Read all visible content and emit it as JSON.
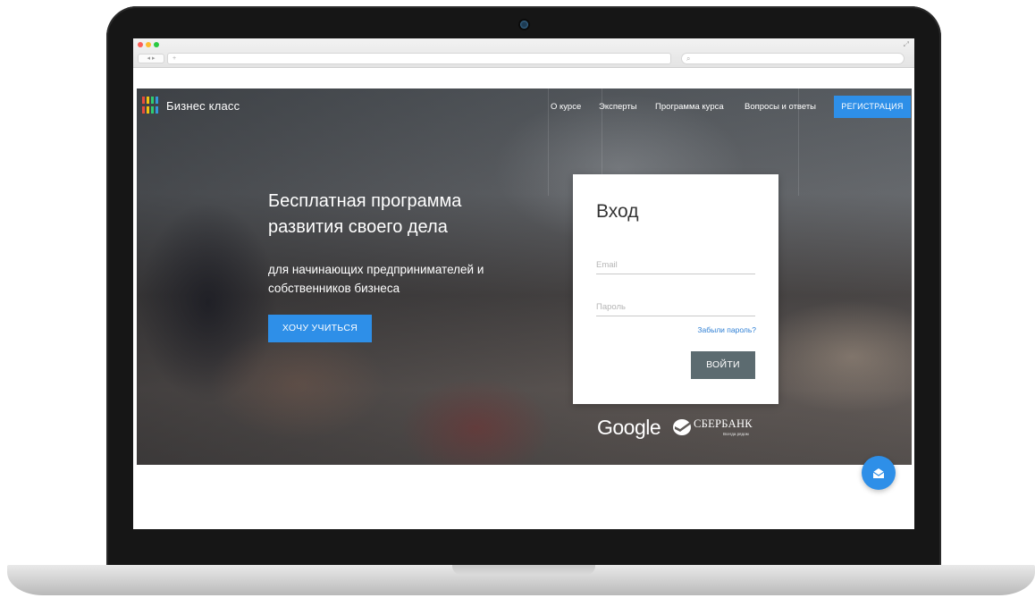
{
  "browser": {
    "nav_arrows": "◂ ▸",
    "url_prefix": "+",
    "search_glyph": "⌕",
    "expand_glyph": "⤢"
  },
  "site": {
    "brand": "Бизнес класс",
    "logo_colors": [
      "#e74c3c",
      "#f1c40f",
      "#2ecc71",
      "#3498db"
    ],
    "accent": "#2e8fe8"
  },
  "nav": {
    "items": [
      {
        "label": "О курсе"
      },
      {
        "label": "Эксперты"
      },
      {
        "label": "Программа курса"
      },
      {
        "label": "Вопросы и ответы"
      }
    ],
    "register_label": "РЕГИСТРАЦИЯ"
  },
  "hero": {
    "title": "Бесплатная программа развития своего дела",
    "subtitle": "для начинающих предпринимателей и собственников бизнеса",
    "cta_label": "ХОЧУ УЧИТЬСЯ"
  },
  "login": {
    "title": "Вход",
    "email_placeholder": "Email",
    "email_value": "",
    "password_placeholder": "Пароль",
    "password_value": "",
    "forgot_label": "Забыли пароль?",
    "submit_label": "ВОЙТИ",
    "submit_color": "#5c6b70"
  },
  "partners": {
    "google": "Google",
    "sberbank": "СБЕРБАНК",
    "sberbank_tagline": "Всегда рядом"
  },
  "chat": {
    "icon": "envelope-open-icon"
  }
}
